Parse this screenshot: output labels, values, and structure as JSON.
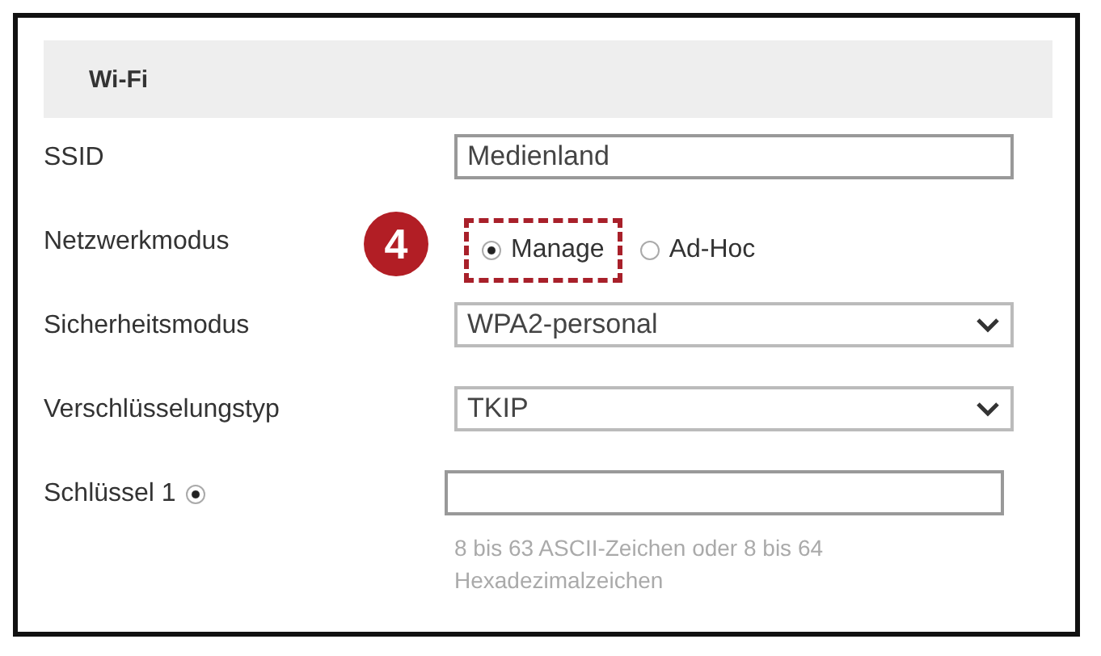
{
  "section_title": "Wi-Fi",
  "rows": [
    {
      "kind": "text",
      "label": "SSID",
      "value": "Medienland"
    },
    {
      "kind": "radio",
      "label": "Netzwerkmodus",
      "badge": "4",
      "options": [
        {
          "label": "Manage",
          "selected": true,
          "highlighted": true
        },
        {
          "label": "Ad-Hoc",
          "selected": false,
          "highlighted": false
        }
      ]
    },
    {
      "kind": "select",
      "label": "Sicherheitsmodus",
      "value": "WPA2-personal"
    },
    {
      "kind": "select",
      "label": "Verschlüsselungstyp",
      "value": "TKIP"
    },
    {
      "kind": "key",
      "label": "Schlüssel 1",
      "selected": true,
      "value": "",
      "hint": "8 bis 63 ASCII-Zeichen oder 8 bis 64 Hexadezimalzeichen"
    }
  ]
}
